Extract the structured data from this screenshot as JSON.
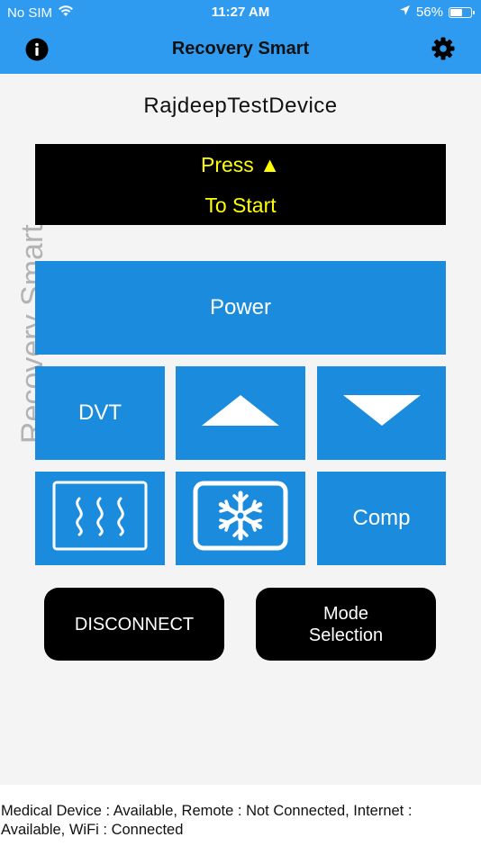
{
  "status_bar": {
    "carrier": "No SIM",
    "time": "11:27 AM",
    "battery": "56%",
    "battery_level": 0.56
  },
  "nav": {
    "title": "Recovery Smart",
    "left_icon": "info-icon",
    "right_icon": "gear-icon"
  },
  "watermark": "Recovery Smart",
  "device_name": "RajdeepTestDevice",
  "display": {
    "line1": "Press ▲",
    "line2": "To Start",
    "text_color": "#ffff00",
    "background": "#000000"
  },
  "buttons": {
    "power": "Power",
    "dvt": "DVT",
    "up_icon": "up-arrow-icon",
    "down_icon": "down-arrow-icon",
    "heat_icon": "heat-icon",
    "cold_icon": "snowflake-icon",
    "comp": "Comp",
    "disconnect": "DISCONNECT",
    "mode_selection_line1": "Mode",
    "mode_selection_line2": "Selection"
  },
  "colors": {
    "accent": "#2f9bf0",
    "button_blue": "#1b8cdd"
  },
  "footer": {
    "status_text": "Medical Device : Available, Remote : Not Connected, Internet : Available, WiFi : Connected"
  }
}
